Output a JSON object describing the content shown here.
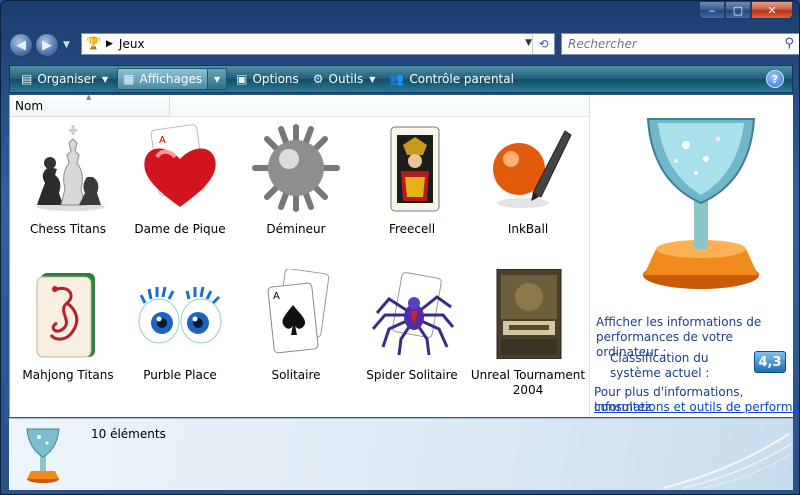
{
  "navigation": {
    "breadcrumb": "Jeux",
    "search_placeholder": "Rechercher"
  },
  "toolbar": {
    "organize": "Organiser",
    "views": "Affichages",
    "options": "Options",
    "tools": "Outils",
    "parental": "Contrôle parental",
    "help": "?"
  },
  "list": {
    "column_name": "Nom"
  },
  "games": [
    {
      "label": "Chess Titans",
      "icon": "chess-icon"
    },
    {
      "label": "Dame de Pique",
      "icon": "hearts-icon"
    },
    {
      "label": "Démineur",
      "icon": "mine-icon"
    },
    {
      "label": "Freecell",
      "icon": "freecell-icon"
    },
    {
      "label": "InkBall",
      "icon": "inkball-icon"
    },
    {
      "label": "Mahjong Titans",
      "icon": "mahjong-icon"
    },
    {
      "label": "Purble Place",
      "icon": "purble-icon"
    },
    {
      "label": "Solitaire",
      "icon": "solitaire-icon"
    },
    {
      "label": "Spider Solitaire",
      "icon": "spider-icon"
    },
    {
      "label": "Unreal Tournament 2004",
      "icon": "unreal-icon"
    }
  ],
  "performance": {
    "info_text": "Afficher les informations de performances de votre ordinateur :",
    "system_label": "Classification du système actuel :",
    "score": "4,3",
    "more_text": "Pour plus d'informations, consultez",
    "link": "Informations et outils de performance"
  },
  "details": {
    "count": "10 éléments"
  },
  "colors": {
    "toolbar": "#1f5f79",
    "link": "#0d45c8",
    "info_text": "#1b3f82"
  }
}
